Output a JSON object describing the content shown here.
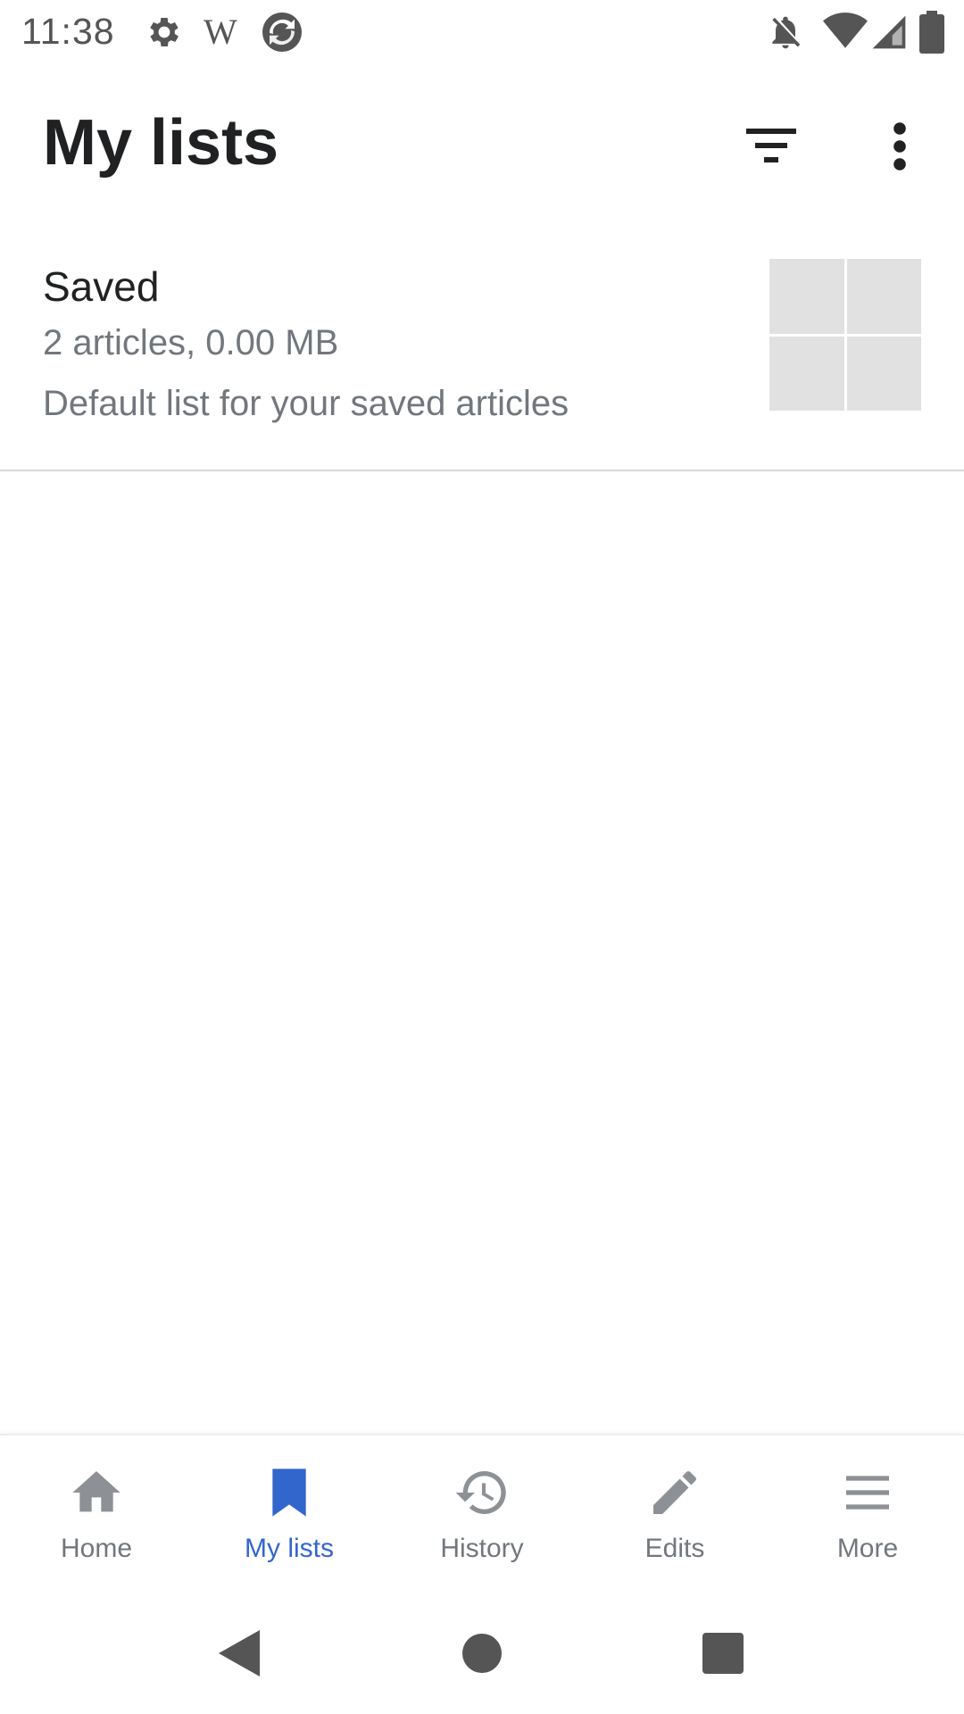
{
  "status_bar": {
    "time": "11:38",
    "app_letter": "W",
    "icons": [
      "gear-icon",
      "wikipedia-w-icon",
      "sync-circle-icon",
      "notifications-off-icon",
      "wifi-icon",
      "cell-signal-icon",
      "battery-icon"
    ]
  },
  "toolbar": {
    "title": "My lists",
    "actions": [
      "filter-icon",
      "more-vert-icon"
    ]
  },
  "lists": [
    {
      "name": "Saved",
      "meta": "2 articles, 0.00 MB",
      "description": "Default list for your saved articles"
    }
  ],
  "bottom_nav": {
    "items": [
      {
        "label": "Home",
        "icon": "home-icon"
      },
      {
        "label": "My lists",
        "icon": "bookmark-icon",
        "active": true
      },
      {
        "label": "History",
        "icon": "history-icon"
      },
      {
        "label": "Edits",
        "icon": "pencil-icon"
      },
      {
        "label": "More",
        "icon": "menu-icon"
      }
    ]
  },
  "system_nav": {
    "buttons": [
      "back-icon",
      "home-circle-icon",
      "recents-icon"
    ]
  },
  "colors": {
    "accent": "#3366cc",
    "text_primary": "#202122",
    "text_secondary": "#72777d",
    "icon_gray": "#8d9196",
    "placeholder": "#e1e1e1"
  }
}
